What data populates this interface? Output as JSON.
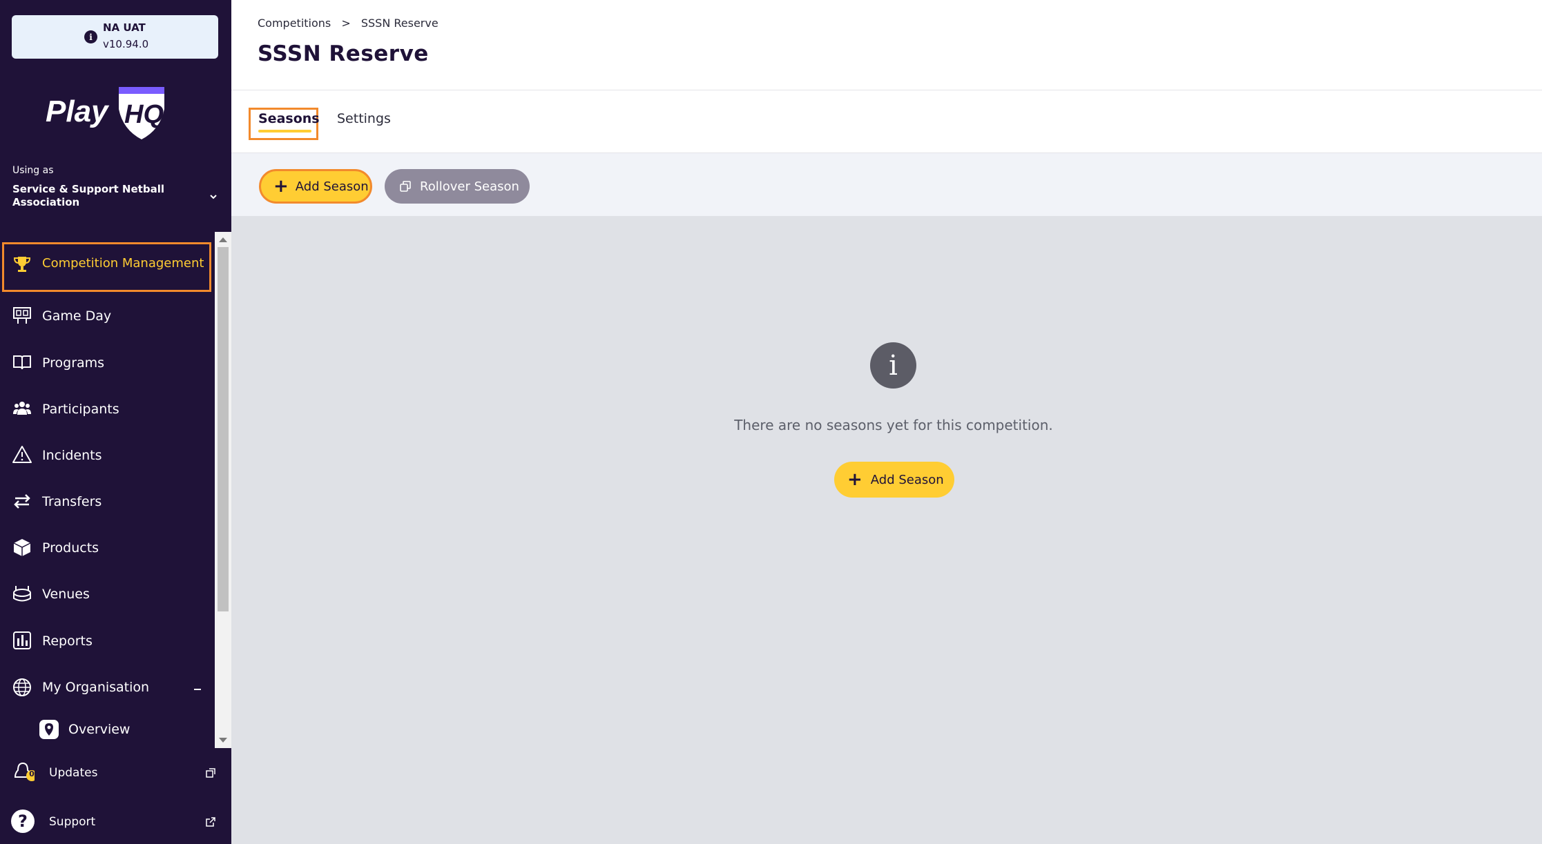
{
  "env": {
    "name": "NA UAT",
    "version": "v10.94.0"
  },
  "sidebar": {
    "using_as": "Using as",
    "org_name": "Service & Support Netball Association",
    "nav": [
      {
        "label": "Competition Management",
        "icon": "trophy-icon"
      },
      {
        "label": "Game Day",
        "icon": "scoreboard-icon"
      },
      {
        "label": "Programs",
        "icon": "book-icon"
      },
      {
        "label": "Participants",
        "icon": "people-icon"
      },
      {
        "label": "Incidents",
        "icon": "warning-icon"
      },
      {
        "label": "Transfers",
        "icon": "transfer-arrows-icon"
      },
      {
        "label": "Products",
        "icon": "box-icon"
      },
      {
        "label": "Venues",
        "icon": "stadium-icon"
      },
      {
        "label": "Reports",
        "icon": "bar-chart-icon"
      },
      {
        "label": "My Organisation",
        "icon": "globe-icon"
      },
      {
        "label": "Overview",
        "icon": "location-pin-icon"
      }
    ],
    "updates": {
      "label": "Updates",
      "count": "0"
    },
    "support": {
      "label": "Support"
    }
  },
  "header": {
    "breadcrumb": [
      "Competitions",
      ">",
      "SSSN Reserve"
    ],
    "title": "SSSN Reserve"
  },
  "tabs": [
    {
      "label": "Seasons"
    },
    {
      "label": "Settings"
    }
  ],
  "toolbar": {
    "add_label": "Add Season",
    "rollover_label": "Rollover Season"
  },
  "empty": {
    "message": "There are no seasons yet for this competition.",
    "add_label": "Add Season"
  },
  "colors": {
    "sidebar_bg": "#1f1238",
    "accent": "#ffcd33",
    "highlight": "#f28a2c"
  }
}
